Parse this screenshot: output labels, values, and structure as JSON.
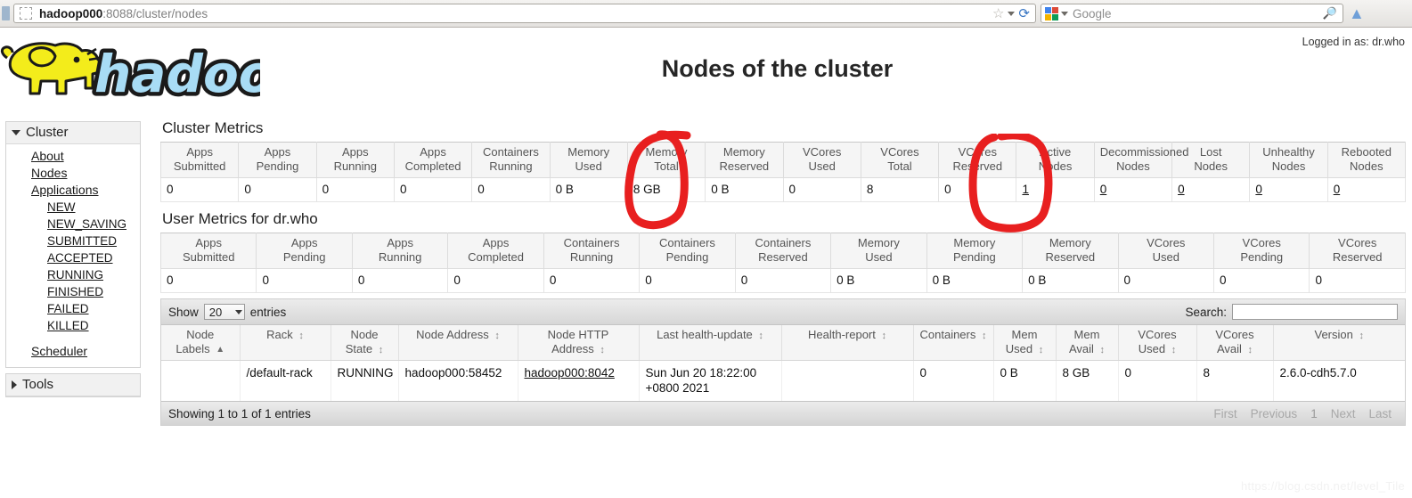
{
  "browser": {
    "url_host": "hadoop000",
    "url_path": ":8088/cluster/nodes",
    "search_placeholder": "Google",
    "star_icon": "star-icon",
    "reload_icon": "reload-icon",
    "binoculars_icon": "binoculars-icon",
    "home_icon": "home-icon"
  },
  "header": {
    "title": "Nodes of the cluster",
    "logged_in": "Logged in as: dr.who",
    "logo_text": "hadoop"
  },
  "sidebar": {
    "cluster_label": "Cluster",
    "tools_label": "Tools",
    "items": [
      {
        "label": "About"
      },
      {
        "label": "Nodes"
      },
      {
        "label": "Applications"
      }
    ],
    "app_states": [
      {
        "label": "NEW"
      },
      {
        "label": "NEW_SAVING"
      },
      {
        "label": "SUBMITTED"
      },
      {
        "label": "ACCEPTED"
      },
      {
        "label": "RUNNING"
      },
      {
        "label": "FINISHED"
      },
      {
        "label": "FAILED"
      },
      {
        "label": "KILLED"
      }
    ],
    "scheduler_label": "Scheduler"
  },
  "cluster_metrics": {
    "heading": "Cluster Metrics",
    "columns": [
      "Apps\nSubmitted",
      "Apps\nPending",
      "Apps\nRunning",
      "Apps\nCompleted",
      "Containers\nRunning",
      "Memory\nUsed",
      "Memory\nTotal",
      "Memory\nReserved",
      "VCores\nUsed",
      "VCores\nTotal",
      "VCores\nReserved",
      "Active\nNodes",
      "Decommissioned\nNodes",
      "Lost\nNodes",
      "Unhealthy\nNodes",
      "Rebooted\nNodes"
    ],
    "values": [
      "0",
      "0",
      "0",
      "0",
      "0",
      "0 B",
      "8 GB",
      "0 B",
      "0",
      "8",
      "0",
      "1",
      "0",
      "0",
      "0",
      "0"
    ],
    "linked": [
      false,
      false,
      false,
      false,
      false,
      false,
      false,
      false,
      false,
      false,
      false,
      true,
      true,
      true,
      true,
      true
    ]
  },
  "user_metrics": {
    "heading": "User Metrics for dr.who",
    "columns": [
      "Apps\nSubmitted",
      "Apps\nPending",
      "Apps\nRunning",
      "Apps\nCompleted",
      "Containers\nRunning",
      "Containers\nPending",
      "Containers\nReserved",
      "Memory\nUsed",
      "Memory\nPending",
      "Memory\nReserved",
      "VCores\nUsed",
      "VCores\nPending",
      "VCores\nReserved"
    ],
    "values": [
      "0",
      "0",
      "0",
      "0",
      "0",
      "0",
      "0",
      "0 B",
      "0 B",
      "0 B",
      "0",
      "0",
      "0"
    ]
  },
  "datatable": {
    "show_label": "Show",
    "entries_label": "entries",
    "page_length": "20",
    "search_label": "Search:",
    "search_value": "",
    "info": "Showing 1 to 1 of 1 entries",
    "paging": [
      {
        "label": "First"
      },
      {
        "label": "Previous"
      },
      {
        "label": "1"
      },
      {
        "label": "Next"
      },
      {
        "label": "Last"
      }
    ],
    "columns": [
      {
        "label": "Node\nLabels",
        "sort": "asc"
      },
      {
        "label": "Rack",
        "sort": "both"
      },
      {
        "label": "Node\nState",
        "sort": "both"
      },
      {
        "label": "Node Address",
        "sort": "both"
      },
      {
        "label": "Node HTTP\nAddress",
        "sort": "both"
      },
      {
        "label": "Last health-update",
        "sort": "both"
      },
      {
        "label": "Health-report",
        "sort": "both"
      },
      {
        "label": "Containers",
        "sort": "both"
      },
      {
        "label": "Mem\nUsed",
        "sort": "both"
      },
      {
        "label": "Mem\nAvail",
        "sort": "both"
      },
      {
        "label": "VCores\nUsed",
        "sort": "both"
      },
      {
        "label": "VCores\nAvail",
        "sort": "both"
      },
      {
        "label": "Version",
        "sort": "both"
      }
    ],
    "rows": [
      {
        "node_labels": "",
        "rack": "/default-rack",
        "node_state": "RUNNING",
        "node_address": "hadoop000:58452",
        "node_http_address": "hadoop000:8042",
        "last_health_update": "Sun Jun 20 18:22:00 +0800 2021",
        "health_report": "",
        "containers": "0",
        "mem_used": "0 B",
        "mem_avail": "8 GB",
        "vcores_used": "0",
        "vcores_avail": "8",
        "version": "2.6.0-cdh5.7.0"
      }
    ]
  },
  "annotations": {
    "color": "#e81f1f",
    "circle_memory_total": "circle around Memory Total column",
    "circle_active_nodes": "circle around Active Nodes column"
  },
  "watermark": "https://blog.csdn.net/level_Tile"
}
